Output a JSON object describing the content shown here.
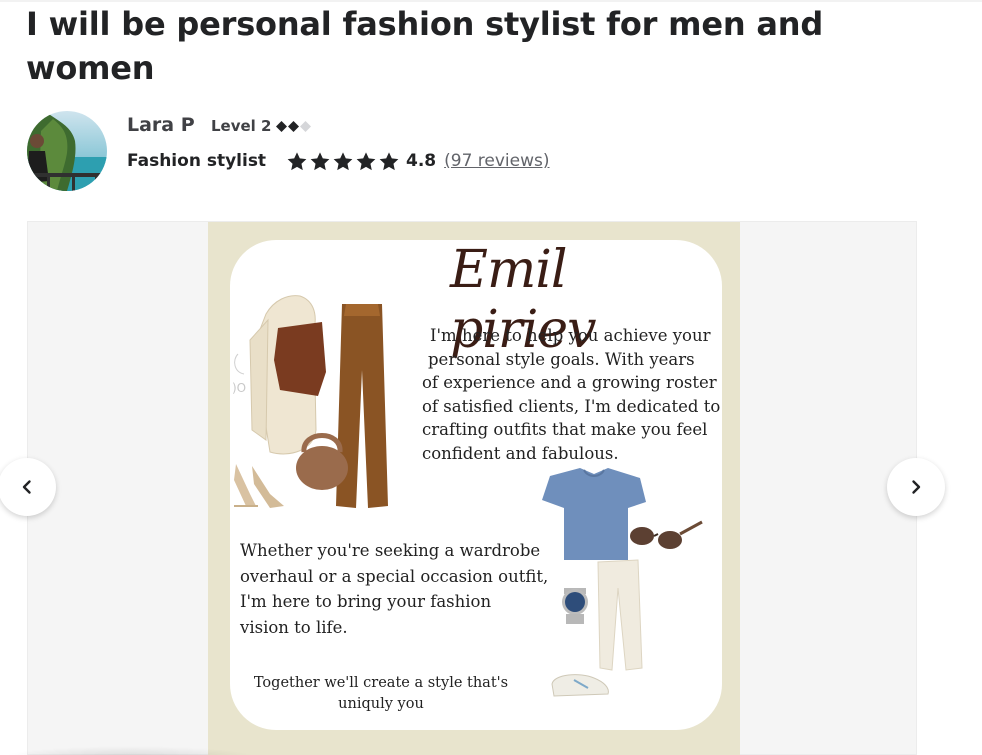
{
  "gig": {
    "title": "I will be personal fashion stylist for men and women"
  },
  "seller": {
    "name": "Lara P",
    "level": "Level 2",
    "tagline": "Fashion stylist",
    "rating": "4.8",
    "stars": 5,
    "reviews_label": "(97 reviews)"
  },
  "gallery": {
    "slide": {
      "signature": "Emil piriev",
      "intro_lines": [
        "I'm here to help you achieve your",
        "personal style goals. With years",
        "of experience and a growing roster",
        "of satisfied clients, I'm dedicated to",
        "crafting outfits that make you feel",
        "confident and fabulous."
      ],
      "middle_lines": [
        "Whether you're seeking a wardrobe",
        "overhaul or a special occasion outfit,",
        "I'm here to bring your fashion",
        "vision to life."
      ],
      "closing_lines": [
        "Together we'll create a style that's",
        "uniquly you"
      ]
    },
    "prev_icon": "chevron-left-icon",
    "next_icon": "chevron-right-icon"
  },
  "colors": {
    "star": "#222325",
    "level_diamond_filled": "#222325",
    "level_diamond_empty": "#c5c6c9",
    "slide_background": "#e8e4cd",
    "signature": "#3a1d15"
  }
}
